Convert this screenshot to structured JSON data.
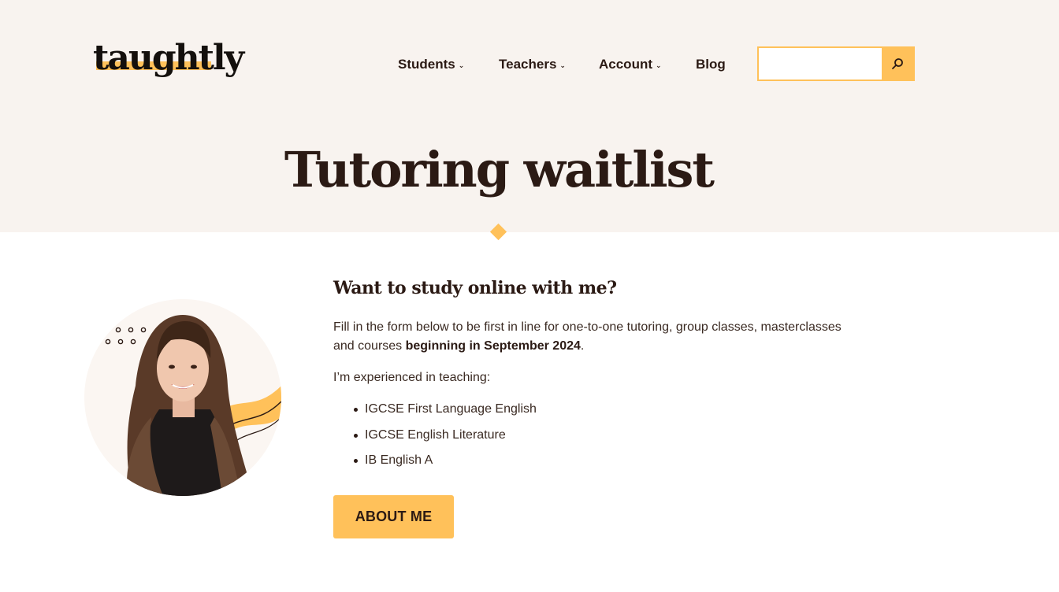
{
  "brand": {
    "logo_text": "taughtly",
    "accent": "#ffc15a",
    "hero_bg": "#f8f3ef",
    "text_color": "#2b1a14"
  },
  "nav": {
    "items": [
      {
        "label": "Students",
        "has_dropdown": true
      },
      {
        "label": "Teachers",
        "has_dropdown": true
      },
      {
        "label": "Account",
        "has_dropdown": true
      },
      {
        "label": "Blog",
        "has_dropdown": false
      }
    ],
    "dropdown_glyph": "⌄"
  },
  "search": {
    "value": "",
    "placeholder": "",
    "icon": "search-icon"
  },
  "hero": {
    "title": "Tutoring waitlist"
  },
  "main": {
    "heading": "Want to study online with me?",
    "intro_text": "Fill in the form below to be first in line for one-to-one tutoring, group classes, masterclasses and courses ",
    "intro_bold": "beginning in September 2024",
    "intro_end": ".",
    "experience_label": "I’m experienced in teaching:",
    "subjects": [
      "IGCSE First Language English",
      "IGCSE English Literature",
      "IB English A"
    ],
    "button_label": "ABOUT ME"
  }
}
